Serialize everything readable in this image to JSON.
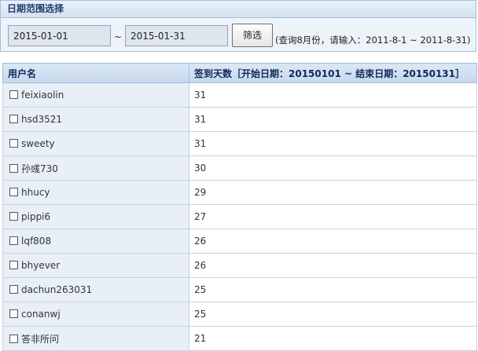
{
  "filter_panel": {
    "title": "日期范围选择",
    "start_date": "2015-01-01",
    "tilde": "~",
    "end_date": "2015-01-31",
    "filter_button": "筛选",
    "hint": "(查询8月份，请输入：2011-8-1 ~ 2011-8-31)"
  },
  "table": {
    "columns": [
      "用户名",
      "签到天数［开始日期：20150101 ~ 结束日期：20150131］"
    ],
    "rows": [
      {
        "username": "feixiaolin",
        "days": "31"
      },
      {
        "username": "hsd3521",
        "days": "31"
      },
      {
        "username": "sweety",
        "days": "31"
      },
      {
        "username": "孙彧730",
        "days": "30"
      },
      {
        "username": "hhucy",
        "days": "29"
      },
      {
        "username": "pippi6",
        "days": "27"
      },
      {
        "username": "lqf808",
        "days": "26"
      },
      {
        "username": "bhyever",
        "days": "26"
      },
      {
        "username": "dachun263031",
        "days": "25"
      },
      {
        "username": "conanwj",
        "days": "25"
      },
      {
        "username": "答非所问",
        "days": "21"
      }
    ]
  }
}
